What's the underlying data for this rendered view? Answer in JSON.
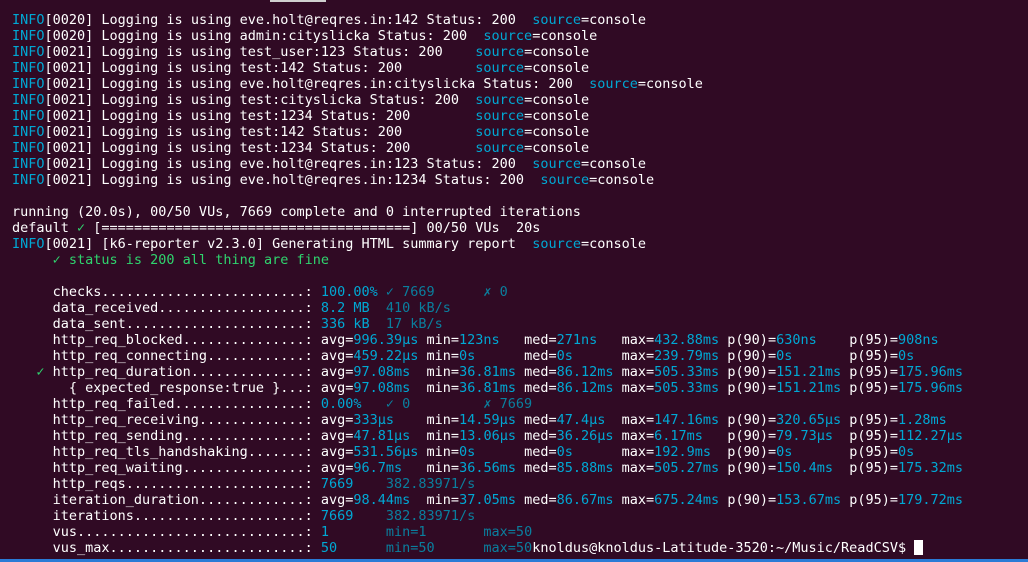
{
  "terminal": {
    "lines": [
      [
        {
          "t": "INFO",
          "c": "cyan"
        },
        {
          "t": "[0020] Logging is using eve.holt@reqres.in:142 Status: 200  "
        },
        {
          "t": "source",
          "c": "cyan"
        },
        {
          "t": "=console"
        }
      ],
      [
        {
          "t": "INFO",
          "c": "cyan"
        },
        {
          "t": "[0020] Logging is using admin:cityslicka Status: 200  "
        },
        {
          "t": "source",
          "c": "cyan"
        },
        {
          "t": "=console"
        }
      ],
      [
        {
          "t": "INFO",
          "c": "cyan"
        },
        {
          "t": "[0021] Logging is using test_user:123 Status: 200    "
        },
        {
          "t": "source",
          "c": "cyan"
        },
        {
          "t": "=console"
        }
      ],
      [
        {
          "t": "INFO",
          "c": "cyan"
        },
        {
          "t": "[0021] Logging is using test:142 Status: 200         "
        },
        {
          "t": "source",
          "c": "cyan"
        },
        {
          "t": "=console"
        }
      ],
      [
        {
          "t": "INFO",
          "c": "cyan"
        },
        {
          "t": "[0021] Logging is using eve.holt@reqres.in:cityslicka Status: 200  "
        },
        {
          "t": "source",
          "c": "cyan"
        },
        {
          "t": "=console"
        }
      ],
      [
        {
          "t": "INFO",
          "c": "cyan"
        },
        {
          "t": "[0021] Logging is using test:cityslicka Status: 200  "
        },
        {
          "t": "source",
          "c": "cyan"
        },
        {
          "t": "=console"
        }
      ],
      [
        {
          "t": "INFO",
          "c": "cyan"
        },
        {
          "t": "[0021] Logging is using test:1234 Status: 200        "
        },
        {
          "t": "source",
          "c": "cyan"
        },
        {
          "t": "=console"
        }
      ],
      [
        {
          "t": "INFO",
          "c": "cyan"
        },
        {
          "t": "[0021] Logging is using test:142 Status: 200         "
        },
        {
          "t": "source",
          "c": "cyan"
        },
        {
          "t": "=console"
        }
      ],
      [
        {
          "t": "INFO",
          "c": "cyan"
        },
        {
          "t": "[0021] Logging is using test:1234 Status: 200        "
        },
        {
          "t": "source",
          "c": "cyan"
        },
        {
          "t": "=console"
        }
      ],
      [
        {
          "t": "INFO",
          "c": "cyan"
        },
        {
          "t": "[0021] Logging is using eve.holt@reqres.in:123 Status: 200  "
        },
        {
          "t": "source",
          "c": "cyan"
        },
        {
          "t": "=console"
        }
      ],
      [
        {
          "t": "INFO",
          "c": "cyan"
        },
        {
          "t": "[0021] Logging is using eve.holt@reqres.in:1234 Status: 200  "
        },
        {
          "t": "source",
          "c": "cyan"
        },
        {
          "t": "=console"
        }
      ],
      [],
      [
        {
          "t": "running (20.0s), 00/50 VUs, 7669 complete and 0 interrupted iterations"
        }
      ],
      [
        {
          "t": "default "
        },
        {
          "t": "✓",
          "c": "green"
        },
        {
          "t": " [======================================] 00/50 VUs  20s"
        }
      ],
      [
        {
          "t": "INFO",
          "c": "cyan"
        },
        {
          "t": "[0021] [k6-reporter v2.3.0] Generating HTML summary report  "
        },
        {
          "t": "source",
          "c": "cyan"
        },
        {
          "t": "=console"
        }
      ],
      [
        {
          "t": "     ✓ status is 200 all thing are fine",
          "c": "green"
        }
      ],
      [],
      [
        {
          "t": "     checks.........................: "
        },
        {
          "t": "100.00%",
          "c": "cyan"
        },
        {
          "t": " ✓ 7669      ✗ 0",
          "c": "dimc"
        }
      ],
      [
        {
          "t": "     data_received..................: "
        },
        {
          "t": "8.2 MB",
          "c": "cyan"
        },
        {
          "t": "  410 kB/s",
          "c": "dimc"
        }
      ],
      [
        {
          "t": "     data_sent......................: "
        },
        {
          "t": "336 kB",
          "c": "cyan"
        },
        {
          "t": "  17 kB/s",
          "c": "dimc"
        }
      ],
      [
        {
          "t": "     http_req_blocked...............: avg="
        },
        {
          "t": "996.39µs",
          "c": "cyan"
        },
        {
          "t": " min="
        },
        {
          "t": "123ns",
          "c": "cyan"
        },
        {
          "t": "   med="
        },
        {
          "t": "271ns",
          "c": "cyan"
        },
        {
          "t": "   max="
        },
        {
          "t": "432.88ms",
          "c": "cyan"
        },
        {
          "t": " p(90)="
        },
        {
          "t": "630ns",
          "c": "cyan"
        },
        {
          "t": "    p(95)="
        },
        {
          "t": "908ns",
          "c": "cyan"
        }
      ],
      [
        {
          "t": "     http_req_connecting............: avg="
        },
        {
          "t": "459.22µs",
          "c": "cyan"
        },
        {
          "t": " min="
        },
        {
          "t": "0s",
          "c": "cyan"
        },
        {
          "t": "      med="
        },
        {
          "t": "0s",
          "c": "cyan"
        },
        {
          "t": "      max="
        },
        {
          "t": "239.79ms",
          "c": "cyan"
        },
        {
          "t": " p(90)="
        },
        {
          "t": "0s",
          "c": "cyan"
        },
        {
          "t": "       p(95)="
        },
        {
          "t": "0s",
          "c": "cyan"
        }
      ],
      [
        {
          "t": "   ✓ ",
          "c": "green"
        },
        {
          "t": "http_req_duration..............: avg="
        },
        {
          "t": "97.08ms",
          "c": "cyan"
        },
        {
          "t": "  min="
        },
        {
          "t": "36.81ms",
          "c": "cyan"
        },
        {
          "t": " med="
        },
        {
          "t": "86.12ms",
          "c": "cyan"
        },
        {
          "t": " max="
        },
        {
          "t": "505.33ms",
          "c": "cyan"
        },
        {
          "t": " p(90)="
        },
        {
          "t": "151.21ms",
          "c": "cyan"
        },
        {
          "t": " p(95)="
        },
        {
          "t": "175.96ms",
          "c": "cyan"
        }
      ],
      [
        {
          "t": "       { expected_response:true }...: avg="
        },
        {
          "t": "97.08ms",
          "c": "cyan"
        },
        {
          "t": "  min="
        },
        {
          "t": "36.81ms",
          "c": "cyan"
        },
        {
          "t": " med="
        },
        {
          "t": "86.12ms",
          "c": "cyan"
        },
        {
          "t": " max="
        },
        {
          "t": "505.33ms",
          "c": "cyan"
        },
        {
          "t": " p(90)="
        },
        {
          "t": "151.21ms",
          "c": "cyan"
        },
        {
          "t": " p(95)="
        },
        {
          "t": "175.96ms",
          "c": "cyan"
        }
      ],
      [
        {
          "t": "     http_req_failed................: "
        },
        {
          "t": "0.00%",
          "c": "cyan"
        },
        {
          "t": "   ✓ 0         ✗ 7669",
          "c": "dimc"
        }
      ],
      [
        {
          "t": "     http_req_receiving.............: avg="
        },
        {
          "t": "333µs",
          "c": "cyan"
        },
        {
          "t": "    min="
        },
        {
          "t": "14.59µs",
          "c": "cyan"
        },
        {
          "t": " med="
        },
        {
          "t": "47.4µs",
          "c": "cyan"
        },
        {
          "t": "  max="
        },
        {
          "t": "147.16ms",
          "c": "cyan"
        },
        {
          "t": " p(90)="
        },
        {
          "t": "320.65µs",
          "c": "cyan"
        },
        {
          "t": " p(95)="
        },
        {
          "t": "1.28ms",
          "c": "cyan"
        }
      ],
      [
        {
          "t": "     http_req_sending...............: avg="
        },
        {
          "t": "47.81µs",
          "c": "cyan"
        },
        {
          "t": "  min="
        },
        {
          "t": "13.06µs",
          "c": "cyan"
        },
        {
          "t": " med="
        },
        {
          "t": "36.26µs",
          "c": "cyan"
        },
        {
          "t": " max="
        },
        {
          "t": "6.17ms",
          "c": "cyan"
        },
        {
          "t": "   p(90)="
        },
        {
          "t": "79.73µs",
          "c": "cyan"
        },
        {
          "t": "  p(95)="
        },
        {
          "t": "112.27µs",
          "c": "cyan"
        }
      ],
      [
        {
          "t": "     http_req_tls_handshaking.......: avg="
        },
        {
          "t": "531.56µs",
          "c": "cyan"
        },
        {
          "t": " min="
        },
        {
          "t": "0s",
          "c": "cyan"
        },
        {
          "t": "      med="
        },
        {
          "t": "0s",
          "c": "cyan"
        },
        {
          "t": "      max="
        },
        {
          "t": "192.9ms",
          "c": "cyan"
        },
        {
          "t": "  p(90)="
        },
        {
          "t": "0s",
          "c": "cyan"
        },
        {
          "t": "       p(95)="
        },
        {
          "t": "0s",
          "c": "cyan"
        }
      ],
      [
        {
          "t": "     http_req_waiting...............: avg="
        },
        {
          "t": "96.7ms",
          "c": "cyan"
        },
        {
          "t": "   min="
        },
        {
          "t": "36.56ms",
          "c": "cyan"
        },
        {
          "t": " med="
        },
        {
          "t": "85.88ms",
          "c": "cyan"
        },
        {
          "t": " max="
        },
        {
          "t": "505.27ms",
          "c": "cyan"
        },
        {
          "t": " p(90)="
        },
        {
          "t": "150.4ms",
          "c": "cyan"
        },
        {
          "t": "  p(95)="
        },
        {
          "t": "175.32ms",
          "c": "cyan"
        }
      ],
      [
        {
          "t": "     http_reqs......................: "
        },
        {
          "t": "7669",
          "c": "cyan"
        },
        {
          "t": "    382.83971/s",
          "c": "dimc"
        }
      ],
      [
        {
          "t": "     iteration_duration.............: avg="
        },
        {
          "t": "98.44ms",
          "c": "cyan"
        },
        {
          "t": "  min="
        },
        {
          "t": "37.05ms",
          "c": "cyan"
        },
        {
          "t": " med="
        },
        {
          "t": "86.67ms",
          "c": "cyan"
        },
        {
          "t": " max="
        },
        {
          "t": "675.24ms",
          "c": "cyan"
        },
        {
          "t": " p(90)="
        },
        {
          "t": "153.67ms",
          "c": "cyan"
        },
        {
          "t": " p(95)="
        },
        {
          "t": "179.72ms",
          "c": "cyan"
        }
      ],
      [
        {
          "t": "     iterations.....................: "
        },
        {
          "t": "7669",
          "c": "cyan"
        },
        {
          "t": "    382.83971/s",
          "c": "dimc"
        }
      ],
      [
        {
          "t": "     vus............................: "
        },
        {
          "t": "1",
          "c": "cyan"
        },
        {
          "t": "       min=1       max=50",
          "c": "dimc"
        }
      ],
      [
        {
          "t": "     vus_max........................: "
        },
        {
          "t": "50",
          "c": "cyan"
        },
        {
          "t": "      min=50      max=50",
          "c": "dimc"
        },
        {
          "t": "knoldus@knoldus-Latitude-3520:~/Music/ReadCSV$ "
        }
      ]
    ]
  },
  "colors": {
    "background": "#300a24",
    "text": "#ffffff",
    "cyan": "#00a8d4",
    "green": "#2fd46e",
    "dim_cyan": "#0a7f9e",
    "accent_bar": "#2a7bd6"
  }
}
